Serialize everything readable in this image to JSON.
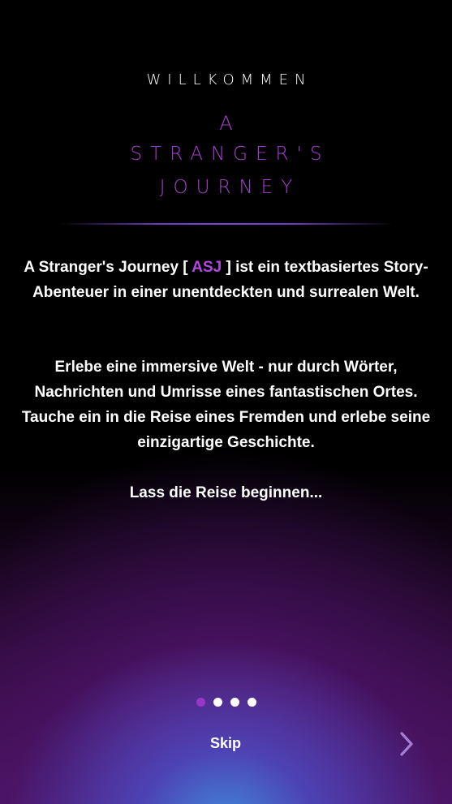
{
  "header": {
    "welcome": "WILLKOMMEN",
    "logo": {
      "line1": "A",
      "line2": "STRANGER'S",
      "line3": "JOURNEY"
    }
  },
  "intro": {
    "p1_before": "A Stranger's Journey [ ",
    "p1_accent": "ASJ",
    "p1_after": " ] ist ein textbasiertes Story-Abenteuer in einer unentdeckten und surrealen Welt.",
    "p2": "Erlebe eine immersive Welt - nur durch Wörter, Nachrichten und Umrisse eines fantastischen Ortes. Tauche ein in die Reise eines Fremden und erlebe seine einzigartige Geschichte.",
    "p3": "Lass die Reise beginnen..."
  },
  "pager": {
    "total": 4,
    "active_index": 0
  },
  "footer": {
    "skip_label": "Skip",
    "next_icon": "chevron-right-icon"
  },
  "colors": {
    "accent": "#b148e0",
    "dot_active": "#9b35c8",
    "dot_inactive": "#ffffff",
    "divider": "#7a46d6"
  }
}
